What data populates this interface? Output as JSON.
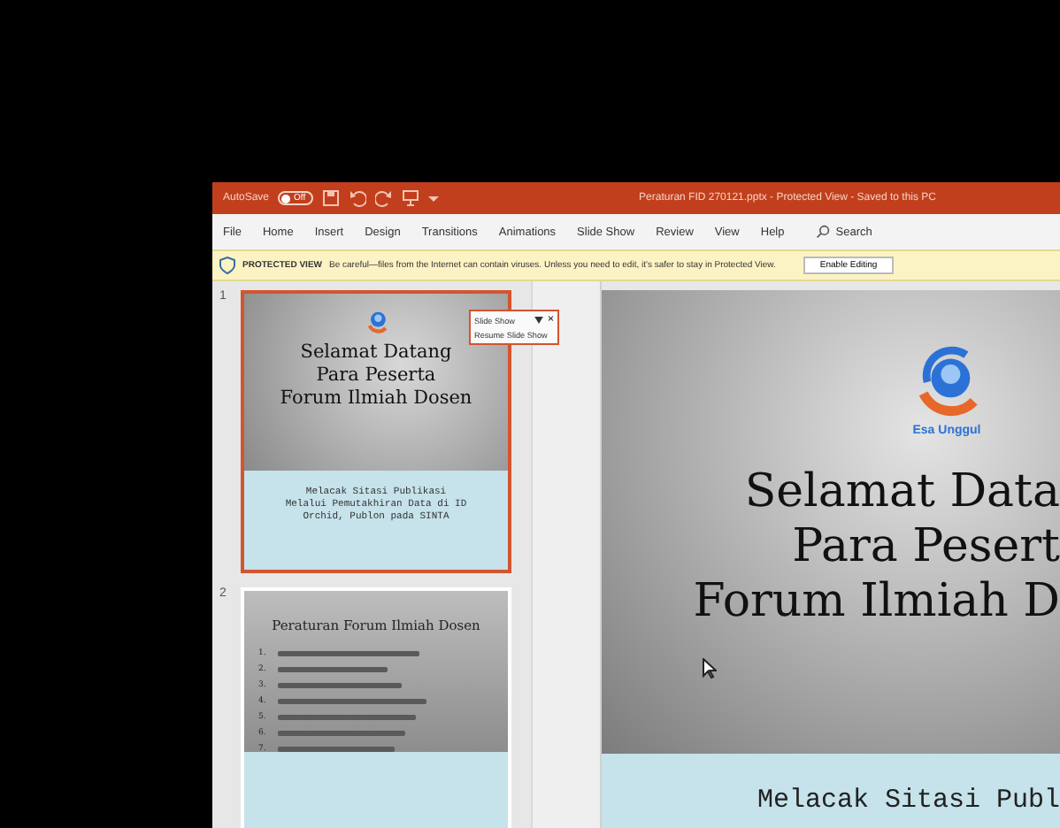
{
  "title_bar": {
    "autosave_label": "AutoSave",
    "autosave_toggle": {
      "label": "Off",
      "on": false
    },
    "document_title": "Peraturan FID 270121.pptx  -  Protected View  -  Saved to this PC"
  },
  "menu": [
    {
      "label": "File"
    },
    {
      "label": "Home"
    },
    {
      "label": "Insert"
    },
    {
      "label": "Design"
    },
    {
      "label": "Transitions"
    },
    {
      "label": "Animations"
    },
    {
      "label": "Slide Show"
    },
    {
      "label": "Review"
    },
    {
      "label": "View"
    },
    {
      "label": "Help"
    }
  ],
  "search": {
    "placeholder": "Search"
  },
  "protected_view": {
    "heading": "PROTECTED VIEW",
    "message": "Be careful—files from the Internet can contain viruses. Unless you need to edit, it's safer to stay in Protected View.",
    "button": "Enable Editing"
  },
  "slides": [
    {
      "number": "1",
      "selected": true,
      "kind": "title",
      "lines": [
        "Selamat Datang",
        "Para Peserta",
        "Forum Ilmiah Dosen"
      ],
      "subtitle": [
        "Melacak Sitasi Publikasi",
        "Melalui Pemutakhiran Data di ID",
        "Orchid, Publon pada SINTA"
      ]
    },
    {
      "number": "2",
      "selected": false,
      "kind": "rules",
      "title": "Peraturan Forum Ilmiah Dosen",
      "items": [
        "1.",
        "2.",
        "3.",
        "4.",
        "5.",
        "6.",
        "7."
      ]
    }
  ],
  "slide_show_popup": {
    "title": "Slide Show",
    "close": "×",
    "action": "Resume Slide Show"
  },
  "main_slide": {
    "logo_text": "Esa Unggul",
    "lines": [
      "Selamat Data",
      "Para Pesert",
      "Forum Ilmiah D"
    ],
    "subtitle": "Melacak Sitasi Publ"
  }
}
